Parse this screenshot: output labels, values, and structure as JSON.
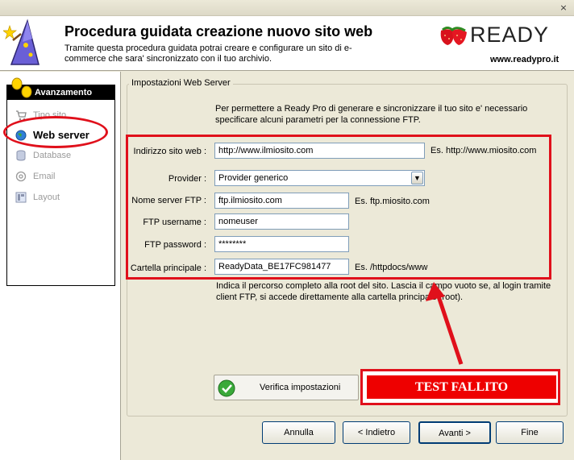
{
  "window": {
    "close_glyph": "×"
  },
  "header": {
    "title": "Procedura guidata creazione nuovo sito web",
    "description": "Tramite questa procedura guidata potrai creare e configurare un sito di e-commerce che sara' sincronizzato con il tuo archivio.",
    "brand": "READY",
    "brand_url": "www.readypro.it",
    "icon": "wizard-hat-icon"
  },
  "sidebar": {
    "title": "Avanzamento",
    "steps": [
      {
        "label": "Tipo sito",
        "icon": "shopping-cart-icon",
        "state": "done"
      },
      {
        "label": "Web server",
        "icon": "globe-icon",
        "state": "active"
      },
      {
        "label": "Database",
        "icon": "database-icon",
        "state": "pending"
      },
      {
        "label": "Email",
        "icon": "email-icon",
        "state": "pending"
      },
      {
        "label": "Layout",
        "icon": "layout-icon",
        "state": "pending"
      }
    ]
  },
  "form": {
    "group_title": "Impostazioni Web Server",
    "intro": "Per permettere a Ready Pro di generare e sincronizzare il tuo sito e' necessario specificare alcuni parametri per la connessione FTP.",
    "fields": {
      "site_address": {
        "label": "Indirizzo sito web :",
        "value": "http://www.ilmiosito.com",
        "example": "Es. http://www.miosito.com"
      },
      "provider": {
        "label": "Provider :",
        "value": "Provider generico"
      },
      "ftp_server": {
        "label": "Nome server FTP :",
        "value": "ftp.ilmiosito.com",
        "example": "Es. ftp.miosito.com"
      },
      "ftp_user": {
        "label": "FTP username :",
        "value": "nomeuser"
      },
      "ftp_password": {
        "label": "FTP password :",
        "value": "********"
      },
      "root_folder": {
        "label": "Cartella principale :",
        "value": "ReadyData_BE17FC981477",
        "example": "Es. /httpdocs/www"
      }
    },
    "hint": "Indica il percorso completo alla root del sito. Lascia il campo vuoto se, al login tramite client FTP, si accede direttamente alla cartella principale (root).",
    "verify_button": "Verifica impostazioni",
    "test_result": "TEST FALLITO"
  },
  "buttons": {
    "cancel": "Annulla",
    "back": "< Indietro",
    "next": "Avanti >",
    "finish": "Fine"
  },
  "colors": {
    "annotation_red": "#e0101b",
    "failure_banner": "#ee0000",
    "dialog_bg": "#ece9d8"
  }
}
